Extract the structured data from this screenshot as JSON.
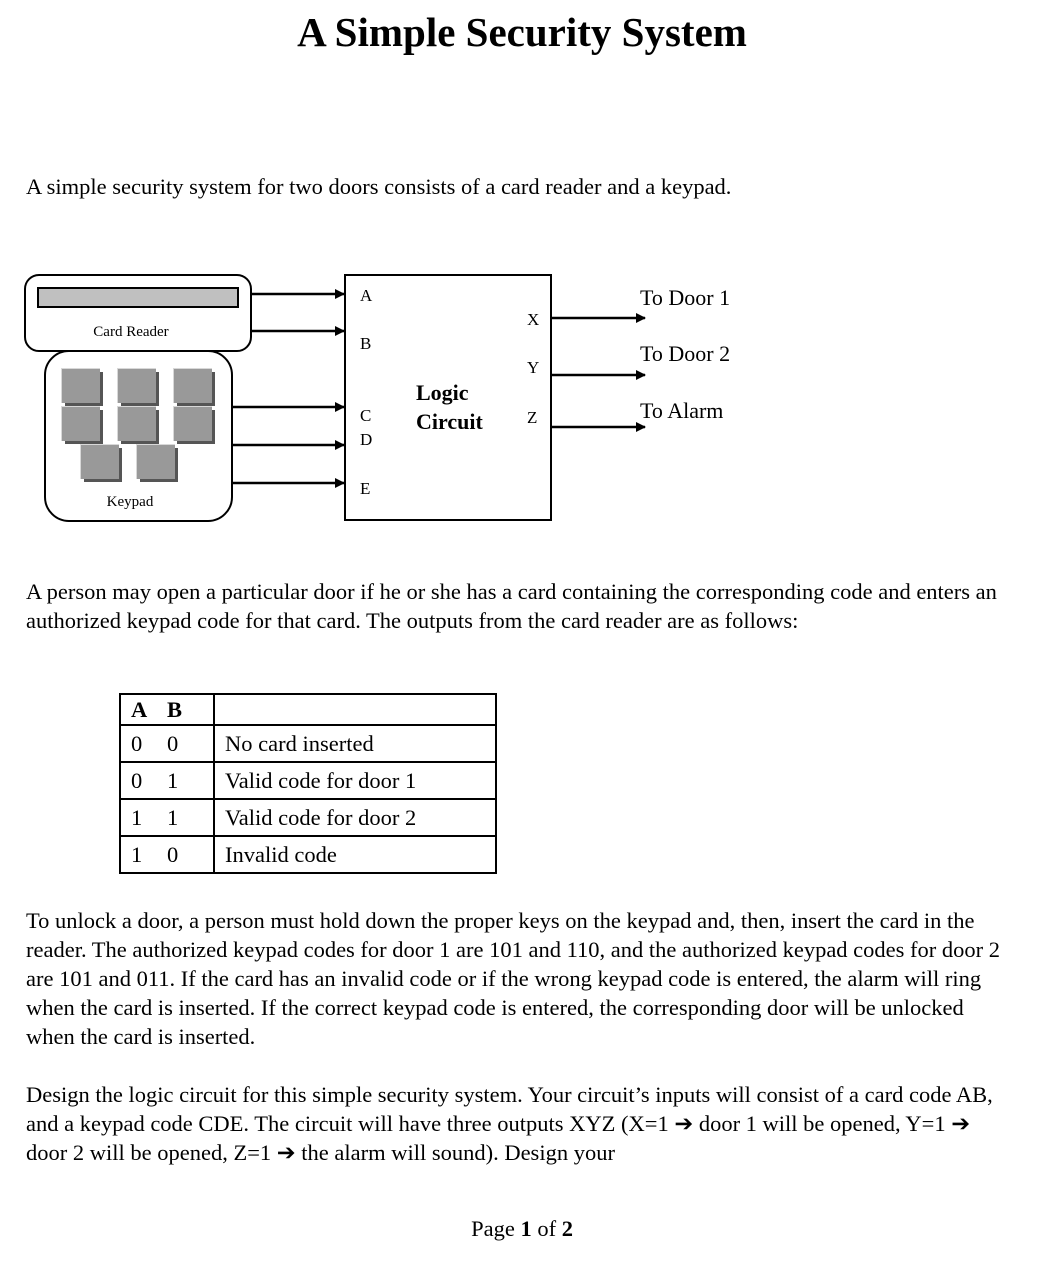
{
  "title": "A Simple Security System",
  "paragraphs": {
    "intro": "A simple security system for two doors consists of a card reader and a keypad.",
    "person": "A person may open a particular door if he or she has a card containing the corresponding code and enters an authorized keypad code for that card.  The outputs from the card reader are as follows:",
    "unlock": "To unlock a door, a person must hold down the proper keys on the keypad and, then, insert the card in the reader.  The authorized keypad codes for door 1 are 101 and 110, and the authorized keypad codes for door 2 are 101 and 011.  If the card has an invalid code or if the wrong keypad code is entered, the alarm will ring when the card is inserted.  If the correct keypad code is entered, the corresponding door will be unlocked when the card is inserted.",
    "design": "Design the logic circuit for this simple security system.  Your circuit’s inputs will consist of a card code AB, and a keypad code CDE.  The circuit will have three outputs XYZ (X=1 ➔ door 1 will be opened, Y=1 ➔ door 2 will be opened, Z=1 ➔ the alarm will sound).  Design your"
  },
  "diagram": {
    "card_reader_label": "Card Reader",
    "keypad_label": "Keypad",
    "logic_label_line1": "Logic",
    "logic_label_line2": "Circuit",
    "inputs": [
      "A",
      "B",
      "C",
      "D",
      "E"
    ],
    "outputs": [
      "X",
      "Y",
      "Z"
    ],
    "output_targets": [
      "To Door 1",
      "To Door 2",
      "To Alarm"
    ],
    "colors": {
      "card_slot": "#c0c0c0",
      "key_face": "#999999",
      "key_shadow": "#555555",
      "key_highlight": "#d8d8d8"
    }
  },
  "card_table": {
    "headers": [
      "A",
      "B",
      ""
    ],
    "rows": [
      {
        "a": "0",
        "b": "0",
        "desc": "No card inserted"
      },
      {
        "a": "0",
        "b": "1",
        "desc": "Valid code for door 1"
      },
      {
        "a": "1",
        "b": "1",
        "desc": "Valid code for door 2"
      },
      {
        "a": "1",
        "b": "0",
        "desc": "Invalid code"
      }
    ]
  },
  "footer": {
    "prefix": "Page ",
    "current": "1",
    "middle": " of ",
    "total": "2"
  }
}
